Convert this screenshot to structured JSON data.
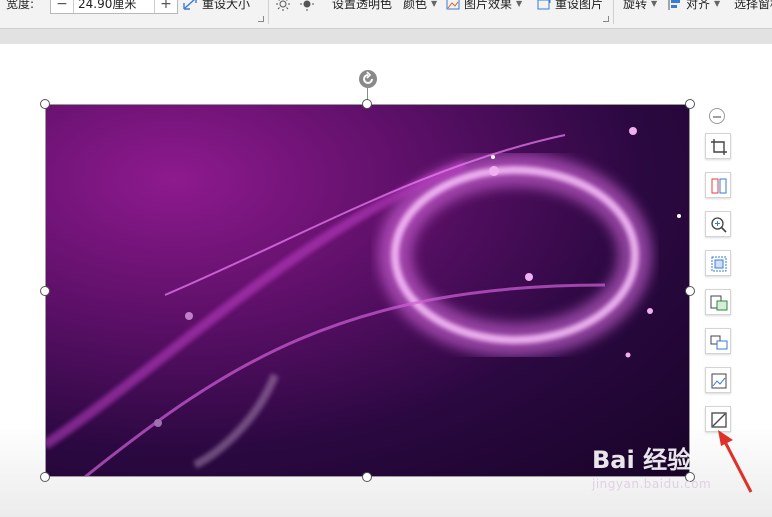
{
  "ribbon": {
    "width_label": "宽度:",
    "width_value": "24.90厘米",
    "minus": "−",
    "plus": "+",
    "reset_size": "重设大小",
    "set_transparent": "设置透明色",
    "color": "颜色",
    "picture_effect": "图片效果",
    "reset_picture": "重设图片",
    "rotate": "旋转",
    "align": "对齐",
    "selection_pane": "选择窗格"
  },
  "watermark": {
    "logo_text": "Bai 经验",
    "url": "jingyan.baidu.com"
  },
  "side_toolbar": [
    "crop-icon",
    "split-icon",
    "zoom-icon",
    "fit-icon",
    "convert-icon",
    "replace-icon",
    "change-picture-icon",
    "picture-border-icon"
  ]
}
